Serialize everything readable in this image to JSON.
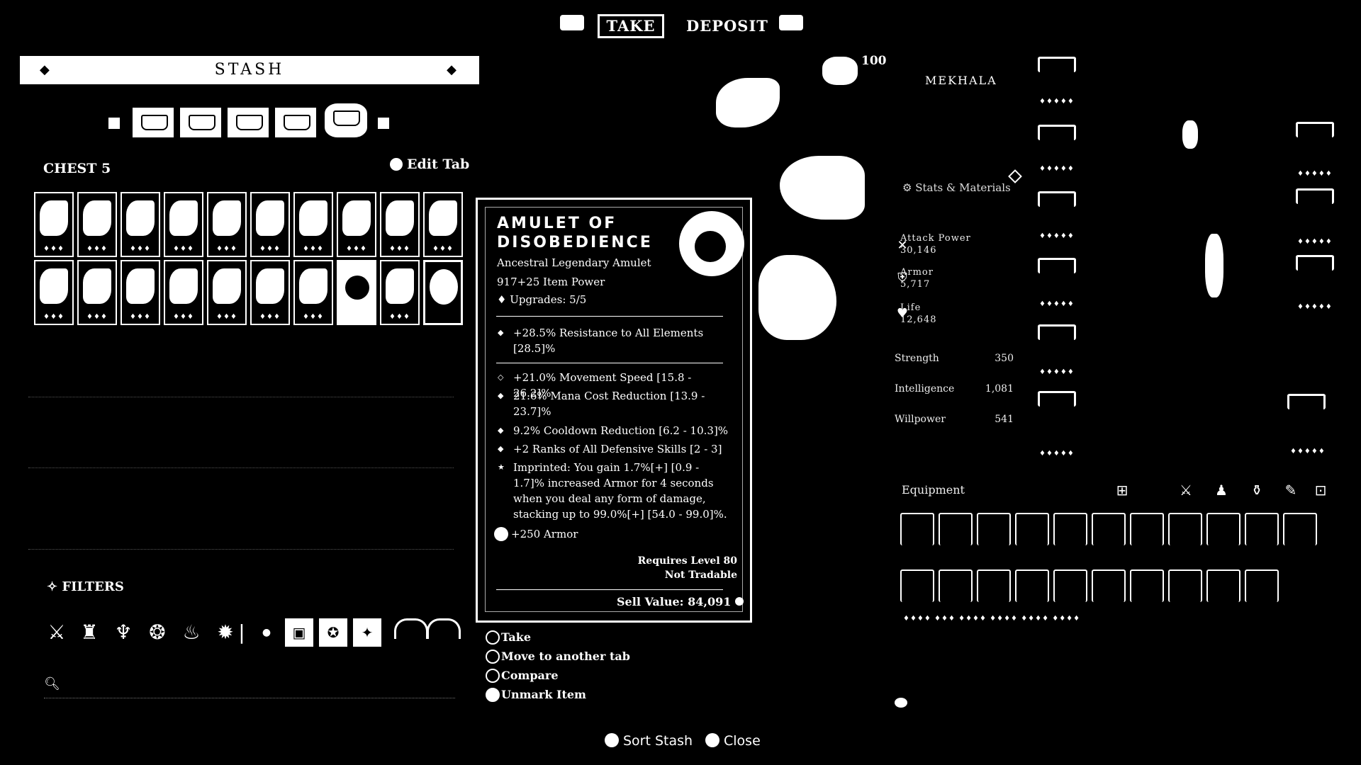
{
  "top_nav": {
    "take_label": "TAKE",
    "deposit_label": "DEPOSIT"
  },
  "stash": {
    "title": "STASH",
    "current_tab": "CHEST 5",
    "edit_tab_label": "Edit Tab",
    "filters_label": "FILTERS",
    "filter_icons": [
      "weapon-icon",
      "armor-chest-icon",
      "charm-icon",
      "gem-icon",
      "potion-icon",
      "spider-icon",
      "dot-icon"
    ]
  },
  "tooltip": {
    "name_line1": "AMULET OF",
    "name_line2": "DISOBEDIENCE",
    "type": "Ancestral Legendary Amulet",
    "item_power": "917+25 Item Power",
    "upgrades": "Upgrades: 5/5",
    "affixes": [
      {
        "bullet": "◆",
        "text": "+28.5% Resistance to All Elements [28.5]%"
      },
      {
        "bullet": "◇",
        "text": "+21.0% Movement Speed [15.8 - 26.2]%"
      },
      {
        "bullet": "◆",
        "text": "21.6% Mana Cost Reduction [13.9 - 23.7]%"
      },
      {
        "bullet": "◆",
        "text": "9.2% Cooldown Reduction [6.2 - 10.3]%"
      },
      {
        "bullet": "◆",
        "text": "+2 Ranks of All Defensive Skills [2 - 3]"
      },
      {
        "bullet": "★",
        "text": "Imprinted: You gain 1.7%[+] [0.9 - 1.7]% increased Armor for 4 seconds when you deal any form of damage, stacking up to 99.0%[+] [54.0 - 99.0]%."
      }
    ],
    "armor_bonus": "+250 Armor",
    "requires_level": "Requires Level 80",
    "tradable": "Not Tradable",
    "sell_value": "Sell Value: 84,091"
  },
  "context_menu": [
    "Take",
    "Move to another tab",
    "Compare",
    "Unmark Item"
  ],
  "bottom_prompts": {
    "sort": "Sort Stash",
    "close": "Close"
  },
  "character": {
    "level": "100",
    "name": "MEKHALA",
    "stats_materials_label": "Stats & Materials",
    "stats": [
      {
        "icon": "crossed-swords-icon",
        "label": "Attack Power",
        "value": "30,146"
      },
      {
        "icon": "shield-icon",
        "label": "Armor",
        "value": "5,717"
      },
      {
        "icon": "heart-icon",
        "label": "Life",
        "value": "12,648"
      }
    ],
    "attributes": [
      {
        "name": "Strength",
        "value": "350"
      },
      {
        "name": "Intelligence",
        "value": "1,081"
      },
      {
        "name": "Willpower",
        "value": "541"
      }
    ],
    "equipment_label": "Equipment"
  }
}
